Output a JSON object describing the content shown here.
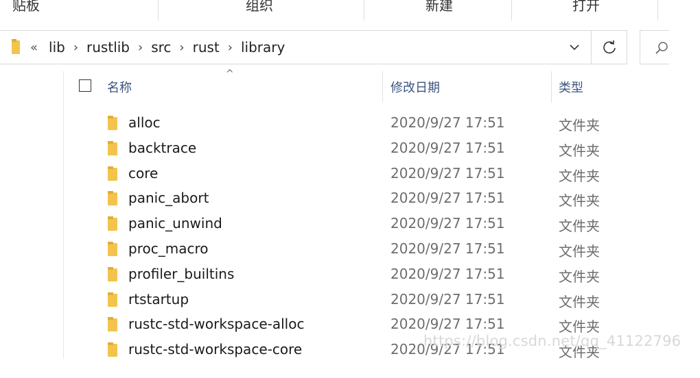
{
  "ribbon": {
    "groups": [
      "贴板",
      "组织",
      "新建",
      "打开"
    ]
  },
  "address_bar": {
    "overflow_marker": "«",
    "breadcrumbs": [
      "lib",
      "rustlib",
      "src",
      "rust",
      "library"
    ]
  },
  "columns": {
    "name": "名称",
    "date_modified": "修改日期",
    "type": "类型"
  },
  "files": [
    {
      "name": "alloc",
      "date": "2020/9/27 17:51",
      "type": "文件夹"
    },
    {
      "name": "backtrace",
      "date": "2020/9/27 17:51",
      "type": "文件夹"
    },
    {
      "name": "core",
      "date": "2020/9/27 17:51",
      "type": "文件夹"
    },
    {
      "name": "panic_abort",
      "date": "2020/9/27 17:51",
      "type": "文件夹"
    },
    {
      "name": "panic_unwind",
      "date": "2020/9/27 17:51",
      "type": "文件夹"
    },
    {
      "name": "proc_macro",
      "date": "2020/9/27 17:51",
      "type": "文件夹"
    },
    {
      "name": "profiler_builtins",
      "date": "2020/9/27 17:51",
      "type": "文件夹"
    },
    {
      "name": "rtstartup",
      "date": "2020/9/27 17:51",
      "type": "文件夹"
    },
    {
      "name": "rustc-std-workspace-alloc",
      "date": "2020/9/27 17:51",
      "type": "文件夹"
    },
    {
      "name": "rustc-std-workspace-core",
      "date": "2020/9/27 17:51",
      "type": "文件夹"
    }
  ],
  "watermark": "https://blog.csdn.net/qq_41122796",
  "colors": {
    "folder": "#f3c44d",
    "header_text": "#3b5580",
    "secondary_text": "#6d6d6d"
  }
}
